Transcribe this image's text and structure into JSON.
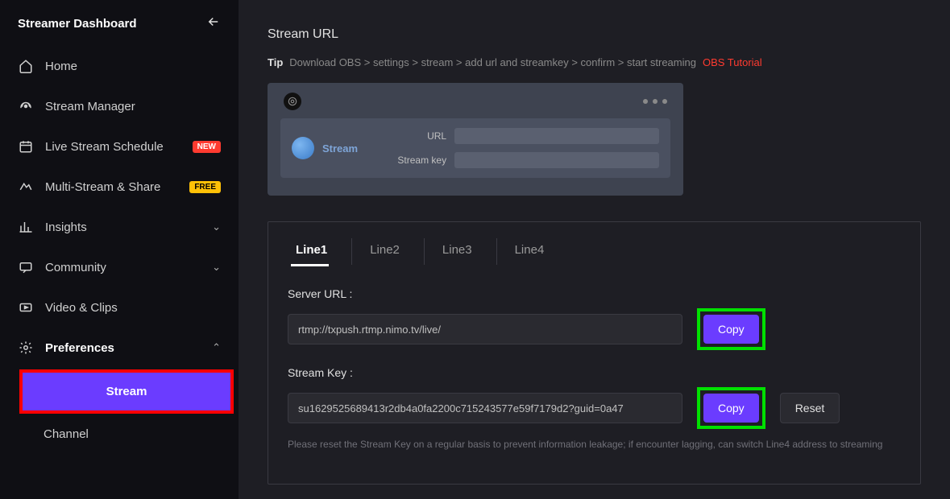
{
  "sidebar": {
    "title": "Streamer Dashboard",
    "items": {
      "home": "Home",
      "streamManager": "Stream Manager",
      "liveSchedule": "Live Stream Schedule",
      "multiStream": "Multi-Stream & Share",
      "insights": "Insights",
      "community": "Community",
      "videoClips": "Video & Clips",
      "preferences": "Preferences"
    },
    "badges": {
      "new": "NEW",
      "free": "FREE"
    },
    "subItems": {
      "stream": "Stream",
      "channel": "Channel"
    }
  },
  "main": {
    "heading": "Stream URL",
    "tipLabel": "Tip",
    "tipText": "Download OBS > settings > stream > add url and streamkey > confirm > start streaming",
    "tutorialLink": "OBS Tutorial",
    "obsPreview": {
      "streamLabel": "Stream",
      "urlLabel": "URL",
      "keyLabel": "Stream key"
    },
    "tabs": [
      "Line1",
      "Line2",
      "Line3",
      "Line4"
    ],
    "serverUrl": {
      "label": "Server URL :",
      "value": "rtmp://txpush.rtmp.nimo.tv/live/",
      "copy": "Copy"
    },
    "streamKey": {
      "label": "Stream Key :",
      "value": "su1629525689413r2db4a0fa2200c715243577e59f7179d2?guid=0a47",
      "copy": "Copy",
      "reset": "Reset"
    },
    "helpText": "Please reset the Stream Key on a regular basis to prevent information leakage; if encounter lagging, can switch Line4 address to streaming"
  }
}
